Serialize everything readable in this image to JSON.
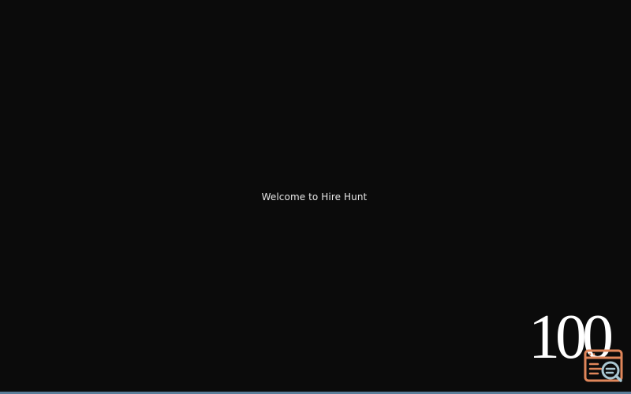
{
  "main": {
    "welcome_text": "Welcome to Hire Hunt"
  },
  "loader": {
    "percent_text": "100",
    "progress_percent": 100
  },
  "launcher": {
    "icon": "browser-search-icon",
    "accent_color": "#e0865a",
    "lens_color": "#a9c7d2"
  },
  "colors": {
    "background": "#0b0b0b",
    "text": "#e6e6e6",
    "bottom_bar": "#5a7d98"
  }
}
